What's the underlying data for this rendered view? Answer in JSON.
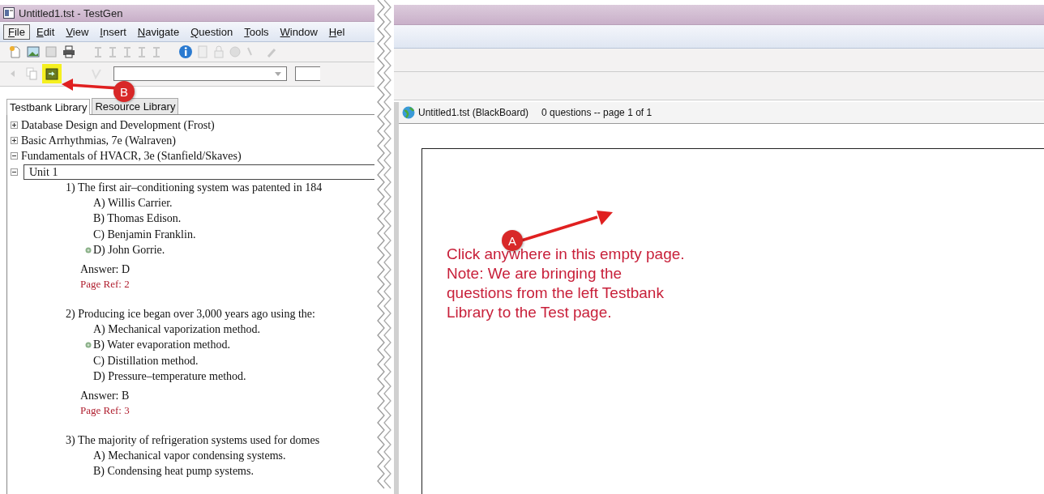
{
  "window": {
    "title": "Untitled1.tst - TestGen"
  },
  "menu": [
    {
      "label": "File",
      "selected": true
    },
    {
      "label": "Edit",
      "selected": false
    },
    {
      "label": "View",
      "selected": false
    },
    {
      "label": "Insert",
      "selected": false
    },
    {
      "label": "Navigate",
      "selected": false
    },
    {
      "label": "Question",
      "selected": false
    },
    {
      "label": "Tools",
      "selected": false
    },
    {
      "label": "Window",
      "selected": false
    },
    {
      "label": "Hel",
      "selected": false
    }
  ],
  "callouts": [
    {
      "label": "B"
    },
    {
      "label": "A"
    }
  ],
  "library_tabs": [
    {
      "label": "Testbank Library",
      "selected": true
    },
    {
      "label": "Resource Library",
      "selected": false
    }
  ],
  "tree": [
    {
      "label": "Database Design and Development (Frost)",
      "expanded": false,
      "selected": false
    },
    {
      "label": "Basic Arrhythmias, 7e (Walraven)",
      "expanded": false,
      "selected": false
    },
    {
      "label": "Fundamentals of HVACR, 3e (Stanfield/Skaves)",
      "expanded": true,
      "selected": false,
      "children": [
        {
          "label": "Unit 1",
          "expanded": true,
          "selected": true,
          "questions": [
            {
              "text": "1) The first air–conditioning system was patented in 184",
              "choices": [
                {
                  "label": "A) Willis Carrier.",
                  "correct": false
                },
                {
                  "label": "B) Thomas Edison.",
                  "correct": false
                },
                {
                  "label": "C) Benjamin Franklin.",
                  "correct": false
                },
                {
                  "label": "D) John Gorrie.",
                  "correct": true
                }
              ],
              "answer": "Answer: D",
              "page_ref": "Page Ref: 2"
            },
            {
              "text": "2) Producing ice began over 3,000 years ago using the:",
              "choices": [
                {
                  "label": "A) Mechanical vaporization method.",
                  "correct": false
                },
                {
                  "label": "B) Water evaporation method.",
                  "correct": true
                },
                {
                  "label": "C) Distillation method.",
                  "correct": false
                },
                {
                  "label": "D) Pressure–temperature method.",
                  "correct": false
                }
              ],
              "answer": "Answer: B",
              "page_ref": "Page Ref: 3"
            },
            {
              "text": "3) The majority of refrigeration systems used for domes",
              "choices": [
                {
                  "label": "A) Mechanical vapor condensing systems.",
                  "correct": false
                },
                {
                  "label": "B) Condensing heat pump systems.",
                  "correct": false
                }
              ]
            }
          ]
        }
      ]
    }
  ],
  "document": {
    "title": "Untitled1.tst (BlackBoard)",
    "status": "0 questions -- page 1 of 1"
  },
  "note": {
    "lines": [
      "Click anywhere in this empty page.",
      "Note: We are bringing the",
      "questions from the left Testbank",
      "Library to the Test page."
    ]
  }
}
